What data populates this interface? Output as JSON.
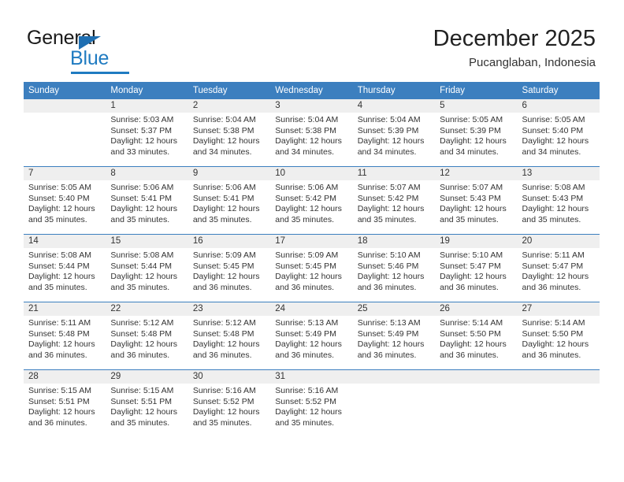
{
  "brand": {
    "name_part1": "General",
    "name_part2": "Blue"
  },
  "header": {
    "title": "December 2025",
    "subtitle": "Pucanglaban, Indonesia"
  },
  "colors": {
    "header_blue": "#3c7fbf",
    "brand_blue": "#1f7bc1",
    "daynum_band": "#efefef",
    "text": "#333333"
  },
  "weekdays": [
    "Sunday",
    "Monday",
    "Tuesday",
    "Wednesday",
    "Thursday",
    "Friday",
    "Saturday"
  ],
  "weeks": [
    [
      {
        "day": "",
        "sunrise": "",
        "sunset": "",
        "daylight": "",
        "daylight2": ""
      },
      {
        "day": "1",
        "sunrise": "Sunrise: 5:03 AM",
        "sunset": "Sunset: 5:37 PM",
        "daylight": "Daylight: 12 hours",
        "daylight2": "and 33 minutes."
      },
      {
        "day": "2",
        "sunrise": "Sunrise: 5:04 AM",
        "sunset": "Sunset: 5:38 PM",
        "daylight": "Daylight: 12 hours",
        "daylight2": "and 34 minutes."
      },
      {
        "day": "3",
        "sunrise": "Sunrise: 5:04 AM",
        "sunset": "Sunset: 5:38 PM",
        "daylight": "Daylight: 12 hours",
        "daylight2": "and 34 minutes."
      },
      {
        "day": "4",
        "sunrise": "Sunrise: 5:04 AM",
        "sunset": "Sunset: 5:39 PM",
        "daylight": "Daylight: 12 hours",
        "daylight2": "and 34 minutes."
      },
      {
        "day": "5",
        "sunrise": "Sunrise: 5:05 AM",
        "sunset": "Sunset: 5:39 PM",
        "daylight": "Daylight: 12 hours",
        "daylight2": "and 34 minutes."
      },
      {
        "day": "6",
        "sunrise": "Sunrise: 5:05 AM",
        "sunset": "Sunset: 5:40 PM",
        "daylight": "Daylight: 12 hours",
        "daylight2": "and 34 minutes."
      }
    ],
    [
      {
        "day": "7",
        "sunrise": "Sunrise: 5:05 AM",
        "sunset": "Sunset: 5:40 PM",
        "daylight": "Daylight: 12 hours",
        "daylight2": "and 35 minutes."
      },
      {
        "day": "8",
        "sunrise": "Sunrise: 5:06 AM",
        "sunset": "Sunset: 5:41 PM",
        "daylight": "Daylight: 12 hours",
        "daylight2": "and 35 minutes."
      },
      {
        "day": "9",
        "sunrise": "Sunrise: 5:06 AM",
        "sunset": "Sunset: 5:41 PM",
        "daylight": "Daylight: 12 hours",
        "daylight2": "and 35 minutes."
      },
      {
        "day": "10",
        "sunrise": "Sunrise: 5:06 AM",
        "sunset": "Sunset: 5:42 PM",
        "daylight": "Daylight: 12 hours",
        "daylight2": "and 35 minutes."
      },
      {
        "day": "11",
        "sunrise": "Sunrise: 5:07 AM",
        "sunset": "Sunset: 5:42 PM",
        "daylight": "Daylight: 12 hours",
        "daylight2": "and 35 minutes."
      },
      {
        "day": "12",
        "sunrise": "Sunrise: 5:07 AM",
        "sunset": "Sunset: 5:43 PM",
        "daylight": "Daylight: 12 hours",
        "daylight2": "and 35 minutes."
      },
      {
        "day": "13",
        "sunrise": "Sunrise: 5:08 AM",
        "sunset": "Sunset: 5:43 PM",
        "daylight": "Daylight: 12 hours",
        "daylight2": "and 35 minutes."
      }
    ],
    [
      {
        "day": "14",
        "sunrise": "Sunrise: 5:08 AM",
        "sunset": "Sunset: 5:44 PM",
        "daylight": "Daylight: 12 hours",
        "daylight2": "and 35 minutes."
      },
      {
        "day": "15",
        "sunrise": "Sunrise: 5:08 AM",
        "sunset": "Sunset: 5:44 PM",
        "daylight": "Daylight: 12 hours",
        "daylight2": "and 35 minutes."
      },
      {
        "day": "16",
        "sunrise": "Sunrise: 5:09 AM",
        "sunset": "Sunset: 5:45 PM",
        "daylight": "Daylight: 12 hours",
        "daylight2": "and 36 minutes."
      },
      {
        "day": "17",
        "sunrise": "Sunrise: 5:09 AM",
        "sunset": "Sunset: 5:45 PM",
        "daylight": "Daylight: 12 hours",
        "daylight2": "and 36 minutes."
      },
      {
        "day": "18",
        "sunrise": "Sunrise: 5:10 AM",
        "sunset": "Sunset: 5:46 PM",
        "daylight": "Daylight: 12 hours",
        "daylight2": "and 36 minutes."
      },
      {
        "day": "19",
        "sunrise": "Sunrise: 5:10 AM",
        "sunset": "Sunset: 5:47 PM",
        "daylight": "Daylight: 12 hours",
        "daylight2": "and 36 minutes."
      },
      {
        "day": "20",
        "sunrise": "Sunrise: 5:11 AM",
        "sunset": "Sunset: 5:47 PM",
        "daylight": "Daylight: 12 hours",
        "daylight2": "and 36 minutes."
      }
    ],
    [
      {
        "day": "21",
        "sunrise": "Sunrise: 5:11 AM",
        "sunset": "Sunset: 5:48 PM",
        "daylight": "Daylight: 12 hours",
        "daylight2": "and 36 minutes."
      },
      {
        "day": "22",
        "sunrise": "Sunrise: 5:12 AM",
        "sunset": "Sunset: 5:48 PM",
        "daylight": "Daylight: 12 hours",
        "daylight2": "and 36 minutes."
      },
      {
        "day": "23",
        "sunrise": "Sunrise: 5:12 AM",
        "sunset": "Sunset: 5:48 PM",
        "daylight": "Daylight: 12 hours",
        "daylight2": "and 36 minutes."
      },
      {
        "day": "24",
        "sunrise": "Sunrise: 5:13 AM",
        "sunset": "Sunset: 5:49 PM",
        "daylight": "Daylight: 12 hours",
        "daylight2": "and 36 minutes."
      },
      {
        "day": "25",
        "sunrise": "Sunrise: 5:13 AM",
        "sunset": "Sunset: 5:49 PM",
        "daylight": "Daylight: 12 hours",
        "daylight2": "and 36 minutes."
      },
      {
        "day": "26",
        "sunrise": "Sunrise: 5:14 AM",
        "sunset": "Sunset: 5:50 PM",
        "daylight": "Daylight: 12 hours",
        "daylight2": "and 36 minutes."
      },
      {
        "day": "27",
        "sunrise": "Sunrise: 5:14 AM",
        "sunset": "Sunset: 5:50 PM",
        "daylight": "Daylight: 12 hours",
        "daylight2": "and 36 minutes."
      }
    ],
    [
      {
        "day": "28",
        "sunrise": "Sunrise: 5:15 AM",
        "sunset": "Sunset: 5:51 PM",
        "daylight": "Daylight: 12 hours",
        "daylight2": "and 36 minutes."
      },
      {
        "day": "29",
        "sunrise": "Sunrise: 5:15 AM",
        "sunset": "Sunset: 5:51 PM",
        "daylight": "Daylight: 12 hours",
        "daylight2": "and 35 minutes."
      },
      {
        "day": "30",
        "sunrise": "Sunrise: 5:16 AM",
        "sunset": "Sunset: 5:52 PM",
        "daylight": "Daylight: 12 hours",
        "daylight2": "and 35 minutes."
      },
      {
        "day": "31",
        "sunrise": "Sunrise: 5:16 AM",
        "sunset": "Sunset: 5:52 PM",
        "daylight": "Daylight: 12 hours",
        "daylight2": "and 35 minutes."
      },
      {
        "day": "",
        "sunrise": "",
        "sunset": "",
        "daylight": "",
        "daylight2": ""
      },
      {
        "day": "",
        "sunrise": "",
        "sunset": "",
        "daylight": "",
        "daylight2": ""
      },
      {
        "day": "",
        "sunrise": "",
        "sunset": "",
        "daylight": "",
        "daylight2": ""
      }
    ]
  ]
}
